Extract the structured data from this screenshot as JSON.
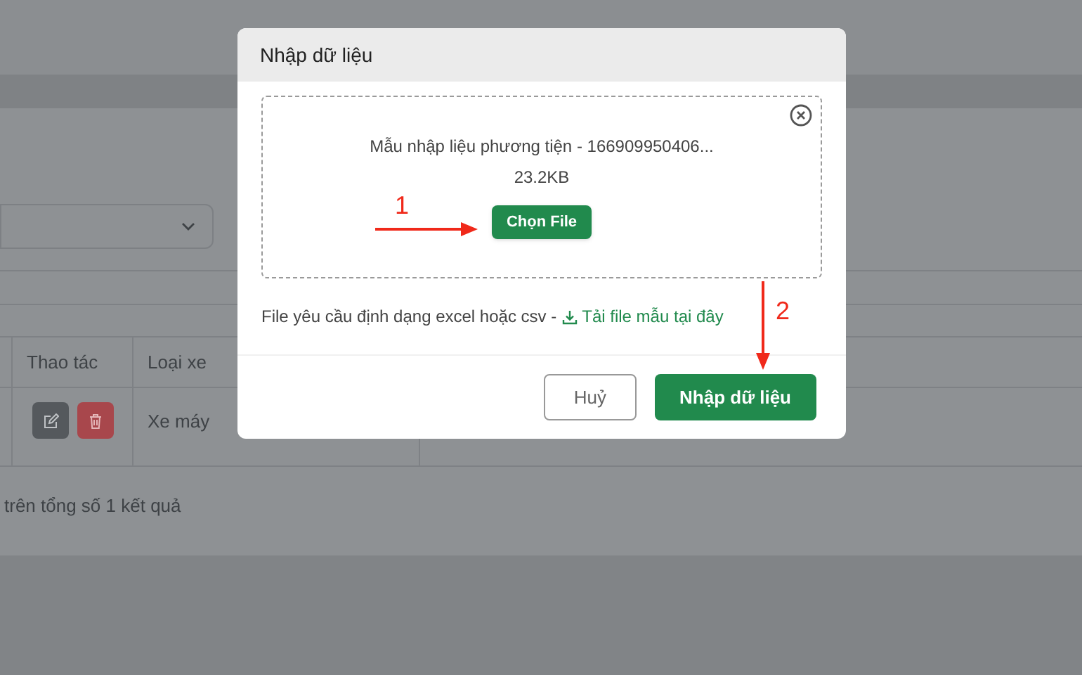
{
  "table": {
    "columns": [
      "Thao tác",
      "Loại xe"
    ],
    "rows": [
      {
        "cells": [
          "",
          "Xe máy"
        ]
      }
    ],
    "footer": "trên tổng số 1 kết quả"
  },
  "modal": {
    "title": "Nhập dữ liệu",
    "file": {
      "name": "Mẫu nhập liệu phương tiện - 166909950406...",
      "size": "23.2KB"
    },
    "choose_button": "Chọn File",
    "hint": {
      "text": "File yêu cầu định dạng excel hoặc csv -",
      "link": "Tải file mẫu tại đây"
    },
    "buttons": [
      {
        "label": "Huỷ",
        "kind": "secondary"
      },
      {
        "label": "Nhập dữ liệu",
        "kind": "primary"
      }
    ]
  },
  "annotations": [
    {
      "label": "1"
    },
    {
      "label": "2"
    }
  ]
}
